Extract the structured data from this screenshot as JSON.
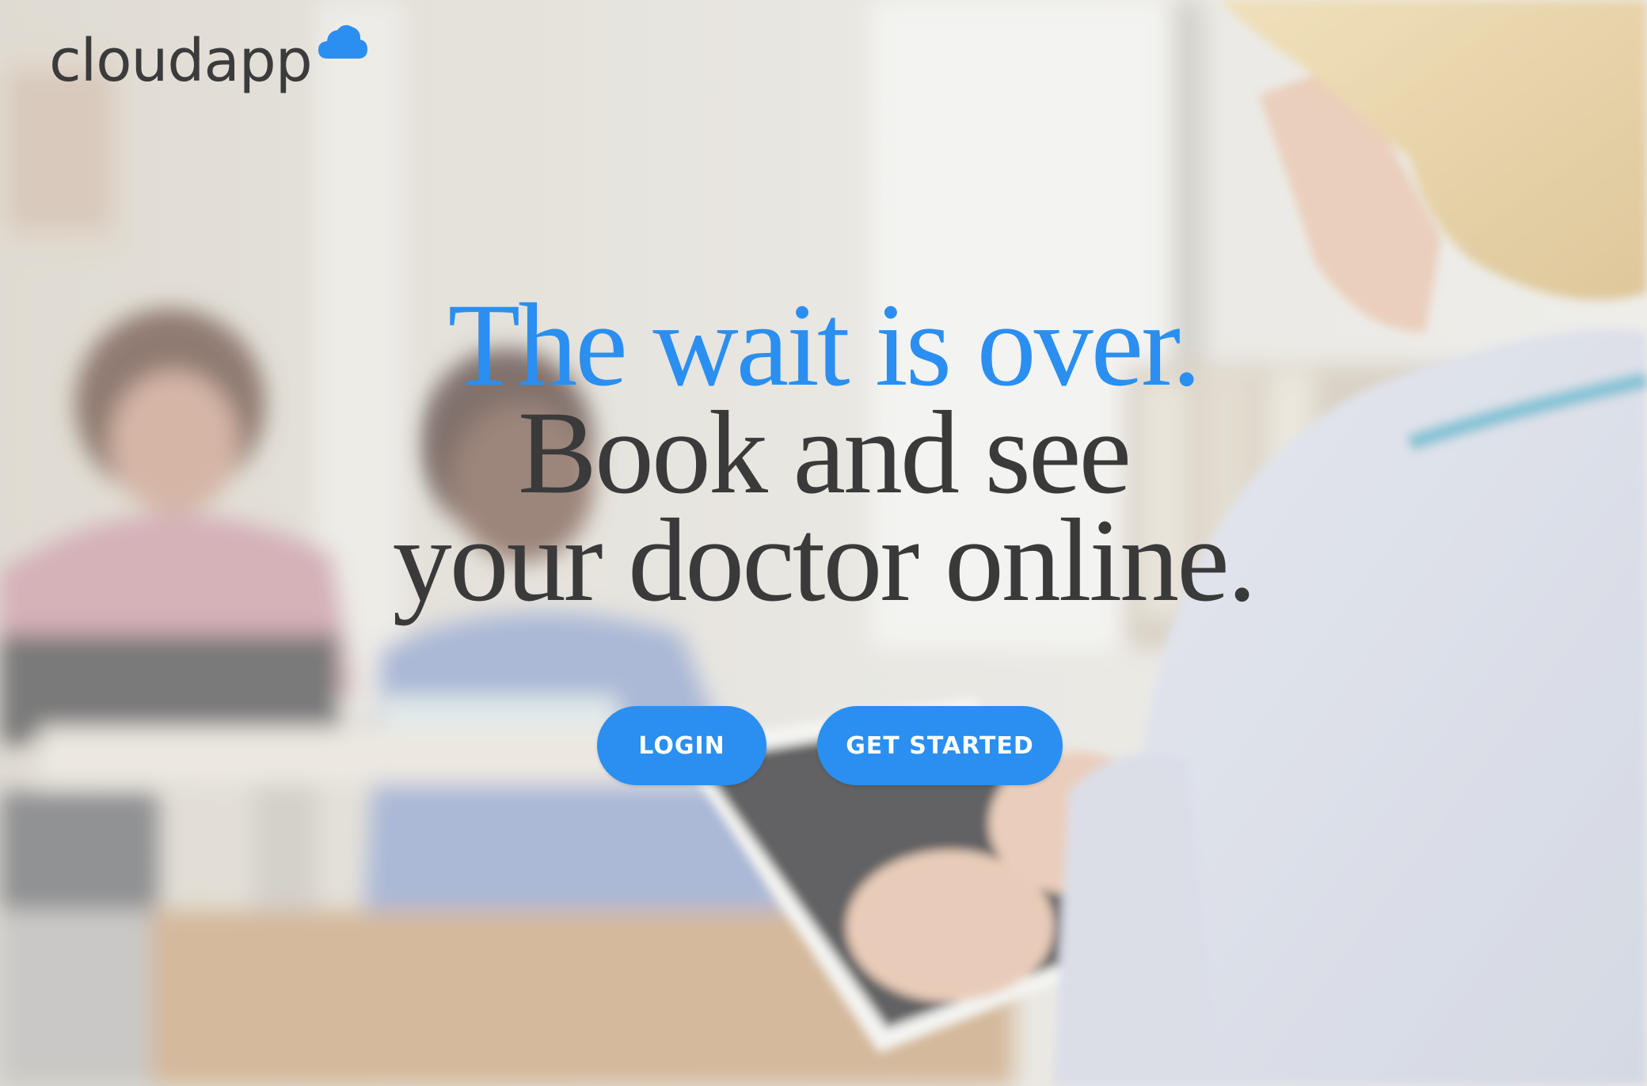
{
  "logo": {
    "text": "cloudapp",
    "icon": "cloud-icon"
  },
  "hero": {
    "headline_accent": "The wait is over.",
    "headline_line2": "Book and see",
    "headline_line3": "your doctor online.",
    "background": "blurred-clinic-photo-doctor-with-tablet"
  },
  "buttons": {
    "login_label": "LOGIN",
    "get_started_label": "GET STARTED"
  },
  "colors": {
    "accent": "#2a8ff0",
    "text_dark": "#3a3a3a",
    "button_text": "#ffffff"
  }
}
